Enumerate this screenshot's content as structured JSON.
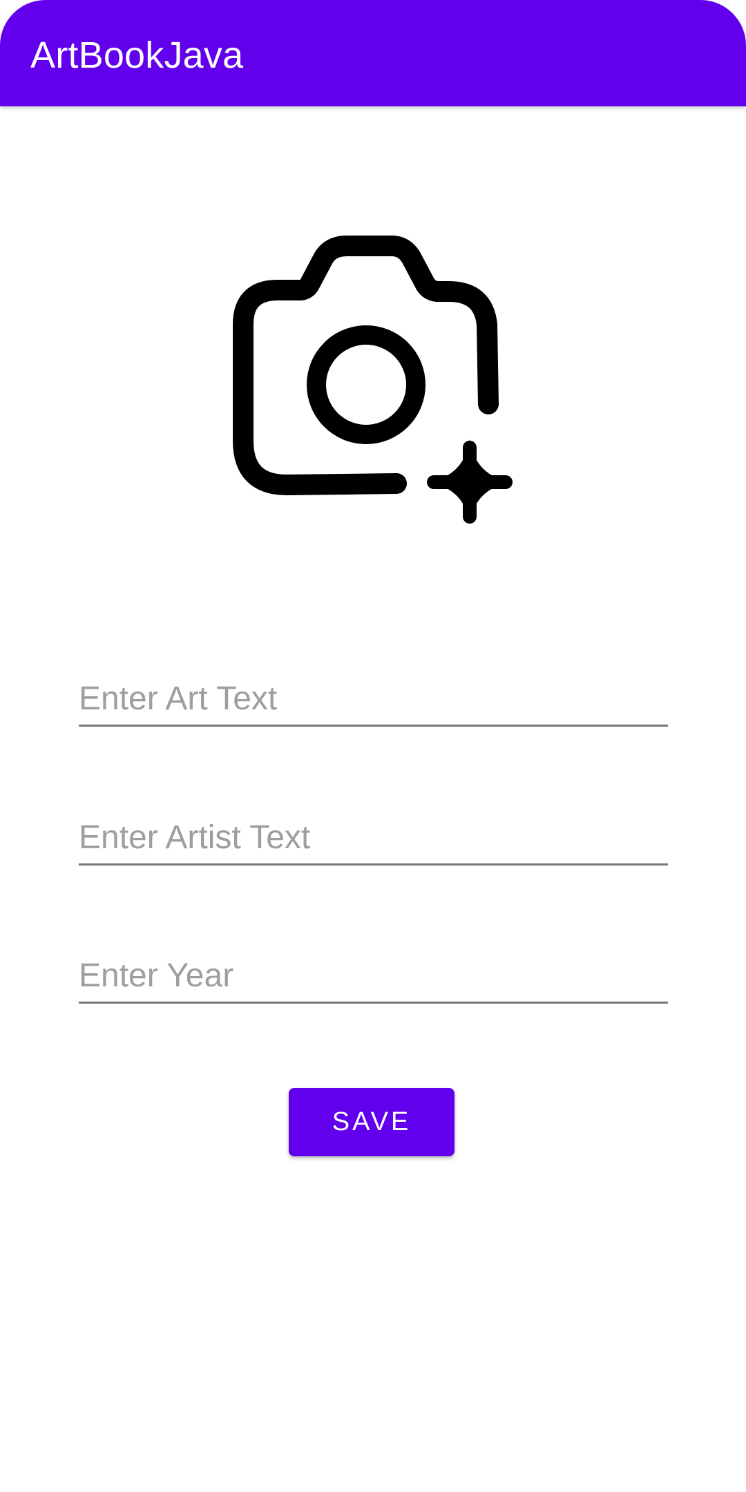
{
  "app_bar": {
    "title": "ArtBookJava"
  },
  "image_picker": {
    "icon": "add-a-photo-icon"
  },
  "fields": {
    "art_placeholder": "Enter Art Text",
    "artist_placeholder": "Enter Artist Text",
    "year_placeholder": "Enter Year"
  },
  "save_button": {
    "label": "SAVE"
  },
  "colors": {
    "primary": "#6200ee",
    "on_primary": "#ffffff",
    "hint": "#9e9e9e",
    "underline": "#757575",
    "icon": "#000000",
    "background": "#ffffff"
  }
}
